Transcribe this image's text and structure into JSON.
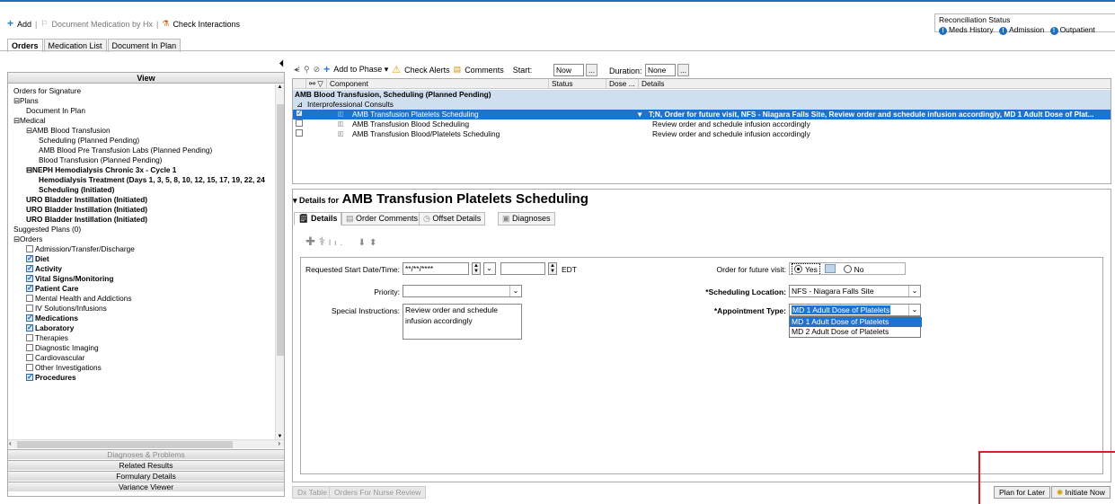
{
  "toolbar": {
    "add": "Add",
    "document_medication": "Document Medication by Hx",
    "check_interactions": "Check Interactions"
  },
  "reconciliation": {
    "title": "Reconciliation Status",
    "meds_history": "Meds History",
    "admission": "Admission",
    "outpatient": "Outpatient"
  },
  "main_tabs": [
    "Orders",
    "Medication List",
    "Document In Plan"
  ],
  "view_panel": {
    "header": "View",
    "tree": [
      {
        "label": "Orders for Signature"
      },
      {
        "label": "Plans"
      },
      {
        "label": "Document In Plan"
      },
      {
        "label": "Medical"
      },
      {
        "label": "AMB Blood Transfusion"
      },
      {
        "label": "Scheduling (Planned Pending)"
      },
      {
        "label": "AMB Blood Pre Transfusion Labs (Planned Pending)"
      },
      {
        "label": "Blood Transfusion (Planned Pending)"
      },
      {
        "label": "NEPH Hemodialysis Chronic 3x - Cycle 1"
      },
      {
        "label": "Hemodialysis Treatment (Days 1, 3, 5, 8, 10, 12, 15, 17, 19, 22, 24"
      },
      {
        "label": "Scheduling (Initiated)"
      },
      {
        "label": "URO Bladder Instillation (Initiated)"
      },
      {
        "label": "URO Bladder Instillation (Initiated)"
      },
      {
        "label": "URO Bladder Instillation (Initiated)"
      },
      {
        "label": "Suggested Plans (0)"
      },
      {
        "label": "Orders"
      },
      {
        "label": "Admission/Transfer/Discharge"
      },
      {
        "label": "Diet"
      },
      {
        "label": "Activity"
      },
      {
        "label": "Vital Signs/Monitoring"
      },
      {
        "label": "Patient Care"
      },
      {
        "label": "Mental Health and Addictions"
      },
      {
        "label": "IV Solutions/Infusions"
      },
      {
        "label": "Medications"
      },
      {
        "label": "Laboratory"
      },
      {
        "label": "Therapies"
      },
      {
        "label": "Diagnostic Imaging"
      },
      {
        "label": "Cardiovascular"
      },
      {
        "label": "Other Investigations"
      },
      {
        "label": "Procedures"
      }
    ],
    "bottom_sections": [
      "Diagnoses & Problems",
      "Related Results",
      "Formulary Details",
      "Variance Viewer"
    ]
  },
  "phase_toolbar": {
    "add_to_phase": "Add to Phase",
    "check_alerts": "Check Alerts",
    "comments": "Comments",
    "start_label": "Start:",
    "start_value": "Now",
    "duration_label": "Duration:",
    "duration_value": "None",
    "ellipsis": "..."
  },
  "grid": {
    "columns": [
      "Component",
      "Status",
      "Dose ...",
      "Details"
    ],
    "plan_header": "AMB Blood Transfusion, Scheduling (Planned Pending)",
    "subheader": "Interprofessional Consults",
    "rows": [
      {
        "component": "AMB Transfusion Platelets Scheduling",
        "details": "T;N, Order for future visit, NFS - Niagara Falls Site, Review order and schedule infusion accordingly, MD 1 Adult Dose of Plat..."
      },
      {
        "component": "AMB Transfusion Blood Scheduling",
        "details": "Review order and schedule infusion accordingly"
      },
      {
        "component": "AMB Transfusion Blood/Platelets Scheduling",
        "details": "Review order and schedule infusion accordingly"
      }
    ]
  },
  "details": {
    "title_prefix": "Details for",
    "title": "AMB Transfusion Platelets Scheduling",
    "tabs": [
      "Details",
      "Order Comments",
      "Offset Details",
      "Diagnoses"
    ],
    "requested_start_label": "Requested Start Date/Time:",
    "requested_start_value": "**/**/****",
    "timezone": "EDT",
    "priority_label": "Priority:",
    "special_instructions_label": "Special Instructions:",
    "special_instructions_value": "Review order and schedule infusion accordingly",
    "future_visit_label": "Order for future visit:",
    "yes": "Yes",
    "no": "No",
    "scheduling_location_label": "*Scheduling Location:",
    "scheduling_location_value": "NFS - Niagara Falls Site",
    "appointment_type_label": "*Appointment Type:",
    "appointment_type_value": "MD 1 Adult Dose of Platelets",
    "appointment_options": [
      "MD 1 Adult Dose of Platelets",
      "MD 2 Adult Dose of Platelets"
    ]
  },
  "bottom_buttons": {
    "dx_table": "Dx Table",
    "orders_for_nurse_review": "Orders For Nurse Review",
    "plan_for_later": "Plan for Later",
    "initiate_now": "Initiate Now"
  }
}
